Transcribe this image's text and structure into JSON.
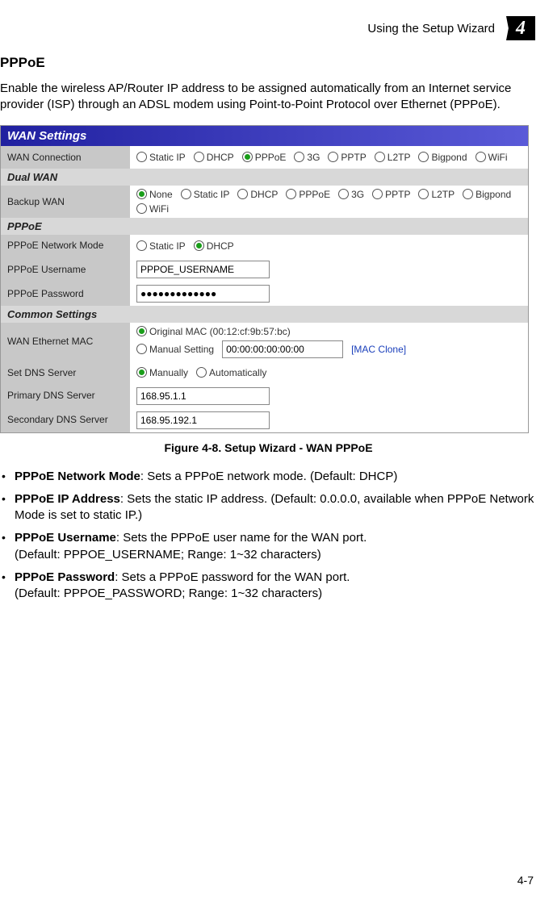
{
  "header": {
    "breadcrumb": "Using the Setup Wizard",
    "chapter_num": "4"
  },
  "section": {
    "title": "PPPoE",
    "intro": "Enable the wireless AP/Router IP address to be assigned automatically from an Internet service provider (ISP) through an ADSL modem using Point-to-Point Protocol over Ethernet (PPPoE)."
  },
  "screenshot": {
    "title": "WAN Settings",
    "wan_connection": {
      "label": "WAN Connection",
      "options": [
        "Static IP",
        "DHCP",
        "PPPoE",
        "3G",
        "PPTP",
        "L2TP",
        "Bigpond",
        "WiFi"
      ],
      "selected": "PPPoE"
    },
    "dual_wan_header": "Dual WAN",
    "backup_wan": {
      "label": "Backup WAN",
      "options": [
        "None",
        "Static IP",
        "DHCP",
        "PPPoE",
        "3G",
        "PPTP",
        "L2TP",
        "Bigpond",
        "WiFi"
      ],
      "selected": "None"
    },
    "pppoe_header": "PPPoE",
    "pppoe_mode": {
      "label": "PPPoE Network Mode",
      "options": [
        "Static IP",
        "DHCP"
      ],
      "selected": "DHCP"
    },
    "pppoe_user": {
      "label": "PPPoE Username",
      "value": "PPPOE_USERNAME"
    },
    "pppoe_pass": {
      "label": "PPPoE Password",
      "value": "●●●●●●●●●●●●●"
    },
    "common_header": "Common Settings",
    "wan_mac": {
      "label": "WAN Ethernet MAC",
      "option_original": "Original MAC (00:12:cf:9b:57:bc)",
      "option_manual": "Manual Setting",
      "manual_value": "00:00:00:00:00:00",
      "clone_link": "[MAC Clone]",
      "selected": "original"
    },
    "dns": {
      "label": "Set DNS Server",
      "options": [
        "Manually",
        "Automatically"
      ],
      "selected": "Manually"
    },
    "dns1": {
      "label": "Primary DNS Server",
      "value": "168.95.1.1"
    },
    "dns2": {
      "label": "Secondary DNS Server",
      "value": "168.95.192.1"
    }
  },
  "figure": {
    "caption": "Figure 4-8.   Setup Wizard - WAN PPPoE"
  },
  "bullets": [
    {
      "head": "PPPoE Network Mode",
      "rest": ": Sets a PPPoE network mode. (Default: DHCP)"
    },
    {
      "head": "PPPoE IP Address",
      "rest": ": Sets the static IP address. (Default: 0.0.0.0, available when PPPoE Network Mode is set to static IP.)"
    },
    {
      "head": "PPPoE Username",
      "rest": ": Sets the PPPoE user name for the WAN port.",
      "line2": "(Default: PPPOE_USERNAME; Range: 1~32 characters)"
    },
    {
      "head": "PPPoE Password",
      "rest": ": Sets a PPPoE password for the WAN port.",
      "line2": "(Default: PPPOE_PASSWORD; Range: 1~32 characters)"
    }
  ],
  "page_num": "4-7"
}
